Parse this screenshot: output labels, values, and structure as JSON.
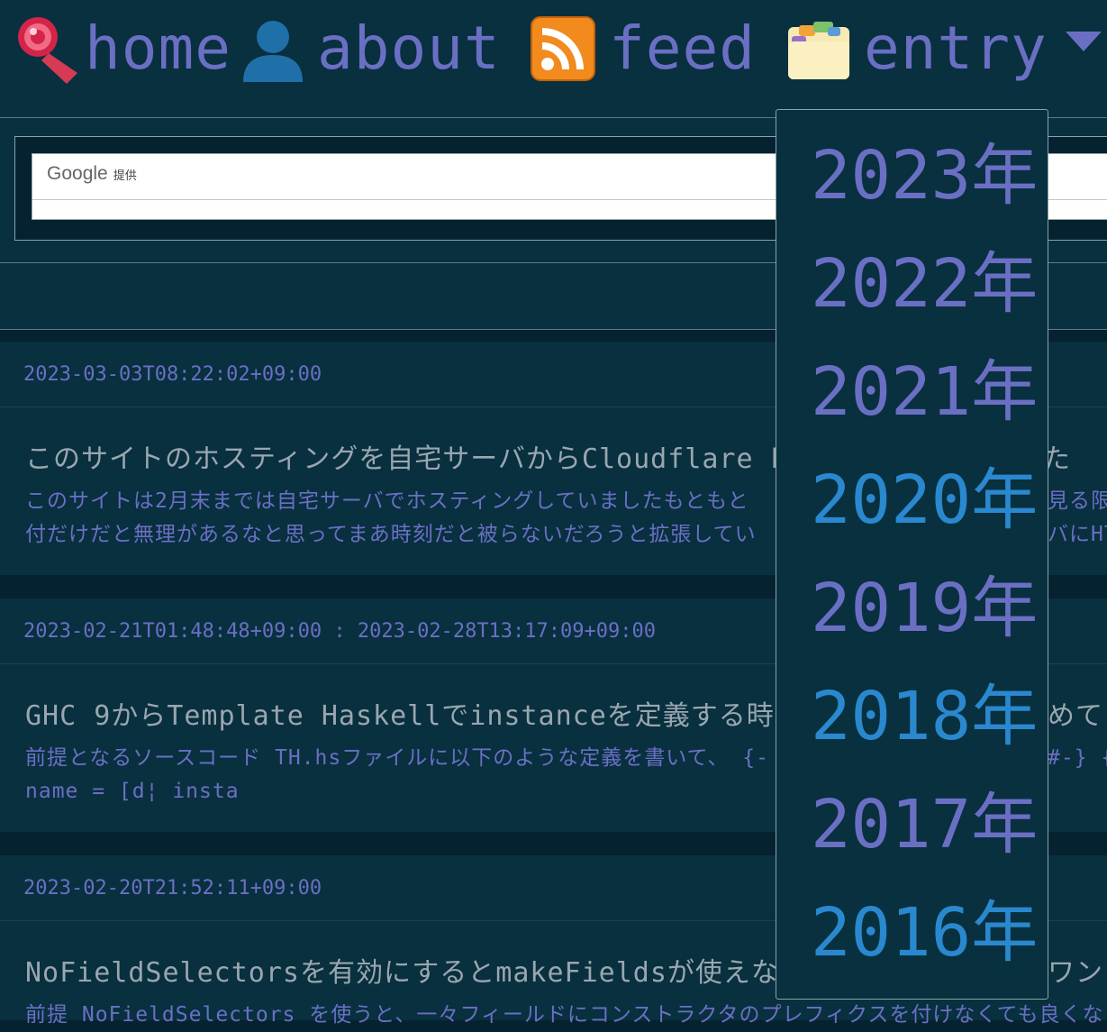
{
  "nav": {
    "home_label": "home",
    "about_label": "about",
    "feed_label": "feed",
    "entry_label": "entry"
  },
  "search": {
    "brand": "Google",
    "brand_suffix": "提供",
    "value": ""
  },
  "articles": [
    {
      "date": "2023-03-03T08:22:02+09:00",
      "title": "このサイトのホスティングを自宅サーバからCloudflare Pa",
      "title_tail": "た",
      "excerpt_line1": "このサイトは2月末までは自宅サーバでホスティングしていましたもともと",
      "excerpt_line1_tail": "見る限",
      "excerpt_line2": "付だけだと無理があるなと思ってまあ時刻だと被らないだろうと拡張してい",
      "excerpt_line2_tail": "バにHTM"
    },
    {
      "date": "2023-02-21T01:48:48+09:00 : 2023-02-28T13:17:09+09:00",
      "title": "GHC 9からTemplate Haskellでinstanceを定義する時に相互",
      "title_tail": "めて",
      "excerpt_line1": "前提となるソースコード TH.hsファイルに以下のような定義を書いて、 {-",
      "excerpt_line1_tail": "#-} {",
      "excerpt_line2": "name = [d¦ insta",
      "excerpt_line2_tail": ""
    },
    {
      "date": "2023-02-20T21:52:11+09:00",
      "title": "NoFieldSelectorsを有効にするとmakeFieldsが使えなくな",
      "title_tail": "ワンド",
      "excerpt_line1": "前提 NoFieldSelectors を使うと、一々フィールドにコンストラクタのプレフィクスを付けなくても良くな",
      "excerpt_line1_tail": "",
      "excerpt_line2": "",
      "excerpt_line2_tail": ""
    }
  ],
  "dropdown": {
    "years": [
      "2023年",
      "2022年",
      "2021年",
      "2020年",
      "2019年",
      "2018年",
      "2017年",
      "2016年"
    ]
  },
  "colors": {
    "link": "#6b6fc4",
    "visited_link": "#2a88cf",
    "background": "#04222f",
    "panel": "#08303f"
  }
}
